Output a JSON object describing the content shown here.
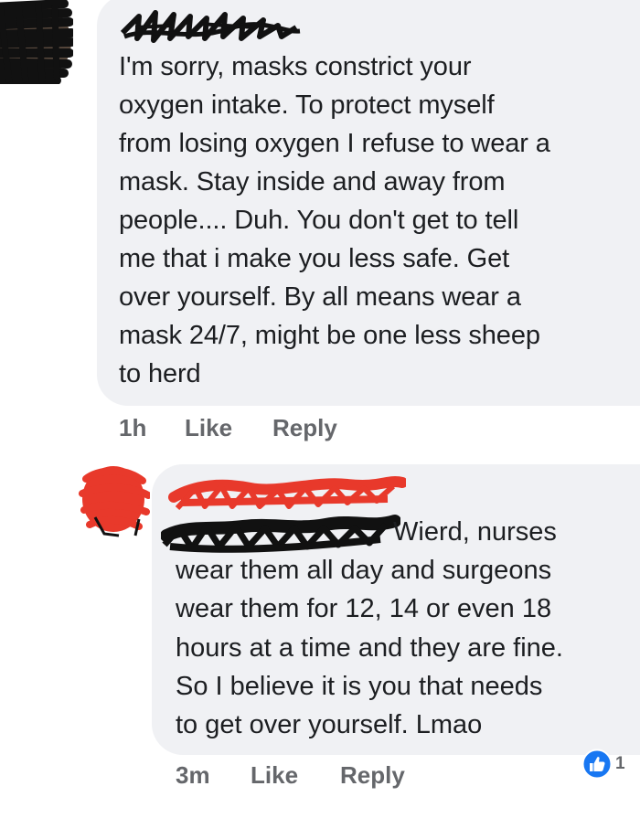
{
  "comments": [
    {
      "lines": [
        "I'm sorry, masks constrict your",
        "oxygen intake. To protect myself",
        "from losing oxygen I refuse to wear a",
        "mask. Stay inside and away from",
        "people.... Duh. You don't get to tell",
        "me that i make you less safe. Get",
        "over yourself.  By all means wear a",
        "mask 24/7, might be one less sheep",
        "to herd"
      ],
      "time": "1h",
      "like_label": "Like",
      "reply_label": "Reply"
    },
    {
      "lines": [
        "Wierd, nurses",
        "wear them all day and surgeons",
        "wear them for 12, 14 or even 18",
        "hours at a time and they are fine.",
        "So I believe it is you that needs",
        "to get over yourself. Lmao"
      ],
      "time": "3m",
      "like_label": "Like",
      "reply_label": "Reply",
      "reaction_count": "1"
    }
  ],
  "colors": {
    "bubble": "#f0f1f4",
    "text": "#1c1e21",
    "meta": "#65676b",
    "like_blue": "#1877f2",
    "red_scribble": "#e8392b",
    "black_scribble": "#111111"
  },
  "icons": {
    "reaction": "thumbs-up-icon"
  }
}
